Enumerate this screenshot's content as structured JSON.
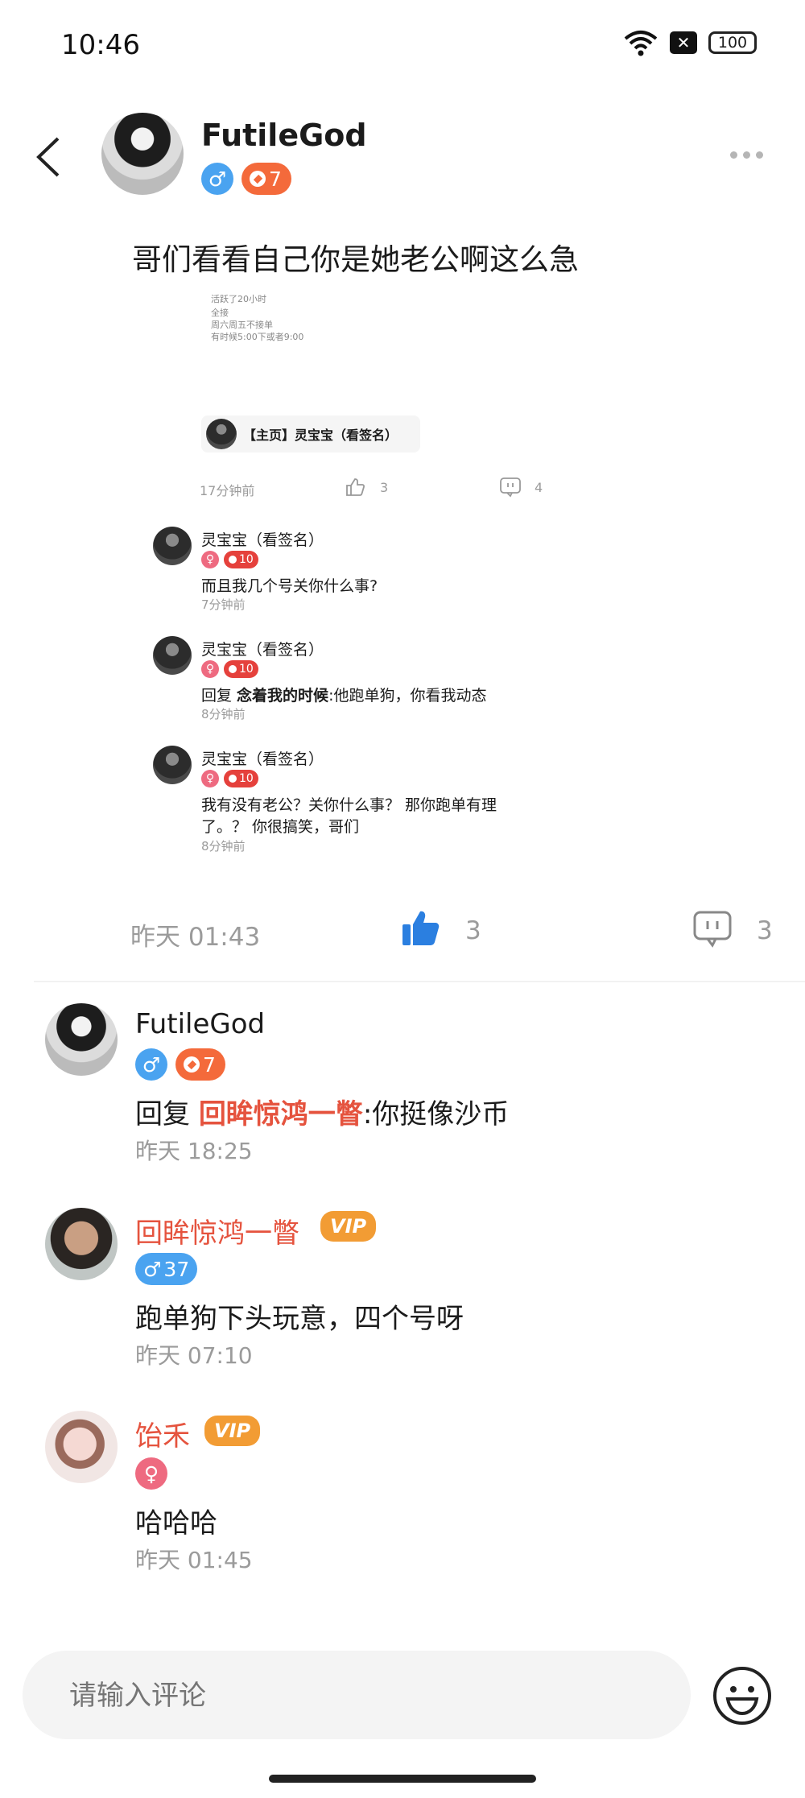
{
  "status_bar": {
    "time": "10:46",
    "battery": "100",
    "sim_icon": "sim-off-icon",
    "wifi_icon": "wifi-icon"
  },
  "post": {
    "author": "FutileGod",
    "level": "7",
    "text": "哥们看看自己你是她老公啊这么急",
    "time": "昨天 01:43",
    "like_count": "3",
    "comment_count": "3"
  },
  "screenshot": {
    "faded_lines": [
      "活跃了20小时",
      "全接",
      "周六周五不接单",
      "有时候5:00下或者9:00"
    ],
    "profile_card": "【主页】灵宝宝（看签名）",
    "time": "17分钟前",
    "likes": "3",
    "comments": "4",
    "replies": [
      {
        "name": "灵宝宝（看签名）",
        "level": "10",
        "text": "而且我几个号关你什么事?",
        "time": "7分钟前"
      },
      {
        "name": "灵宝宝（看签名）",
        "level": "10",
        "prefix": "回复 ",
        "mention": "念着我的时候",
        "text": ":他跑单狗，你看我动态",
        "time": "8分钟前"
      },
      {
        "name": "灵宝宝（看签名）",
        "level": "10",
        "text_line1": "我有没有老公？关你什么事？ 那你跑单有理",
        "text_line2": "了。？ 你很搞笑，哥们",
        "time": "8分钟前"
      }
    ]
  },
  "comments": [
    {
      "name": "FutileGod",
      "level": "7",
      "prefix": "回复 ",
      "mention": "回眸惊鸿一瞥",
      "text": ":你挺像沙币",
      "time": "昨天 18:25"
    },
    {
      "name": "回眸惊鸿一瞥",
      "vip": "VIP",
      "badge": "37",
      "text": "跑单狗下头玩意，四个号呀",
      "time": "昨天 07:10"
    },
    {
      "name": "饴禾",
      "vip": "VIP",
      "text": "哈哈哈",
      "time": "昨天 01:45"
    }
  ],
  "input": {
    "placeholder": "请输入评论"
  },
  "colors": {
    "accent_red": "#e5533e",
    "like_blue": "#2b7fe0",
    "male_blue": "#4aa3f0",
    "level_orange": "#f46a3b",
    "vip_orange": "#f29c34"
  }
}
